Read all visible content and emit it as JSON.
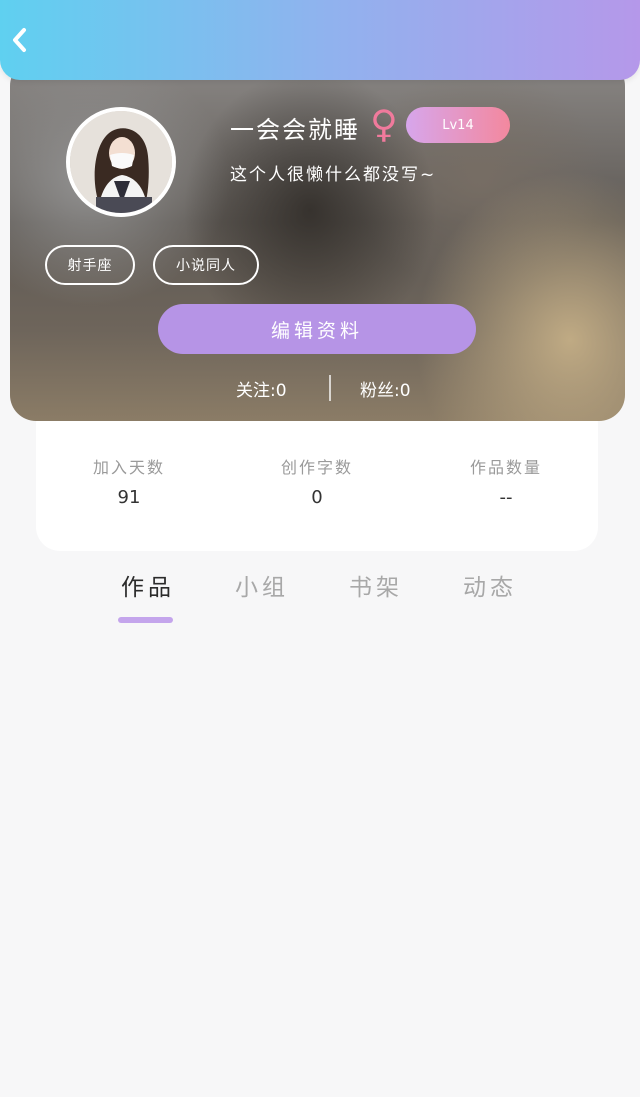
{
  "header": {
    "back_icon": "chevron-left-icon",
    "gradient_colors": [
      "#5fd0f0",
      "#b598ea"
    ]
  },
  "profile": {
    "username": "一会会就睡",
    "gender_symbol": "♀",
    "level": "Lv14",
    "bio": "这个人很懒什么都没写~",
    "tags": [
      "射手座",
      "小说同人"
    ],
    "edit_button": "编辑资料",
    "following": "关注:0",
    "fans": "粉丝:0"
  },
  "stats": [
    {
      "label": "加入天数",
      "value": "91"
    },
    {
      "label": "创作字数",
      "value": "0"
    },
    {
      "label": "作品数量",
      "value": "--"
    }
  ],
  "tabs": [
    {
      "label": "作品",
      "active": true
    },
    {
      "label": "小组",
      "active": false
    },
    {
      "label": "书架",
      "active": false
    },
    {
      "label": "动态",
      "active": false
    }
  ],
  "colors": {
    "accent": "#b694e6",
    "tab_indicator": "#c4a5ec",
    "gender": "#f07a9c"
  }
}
